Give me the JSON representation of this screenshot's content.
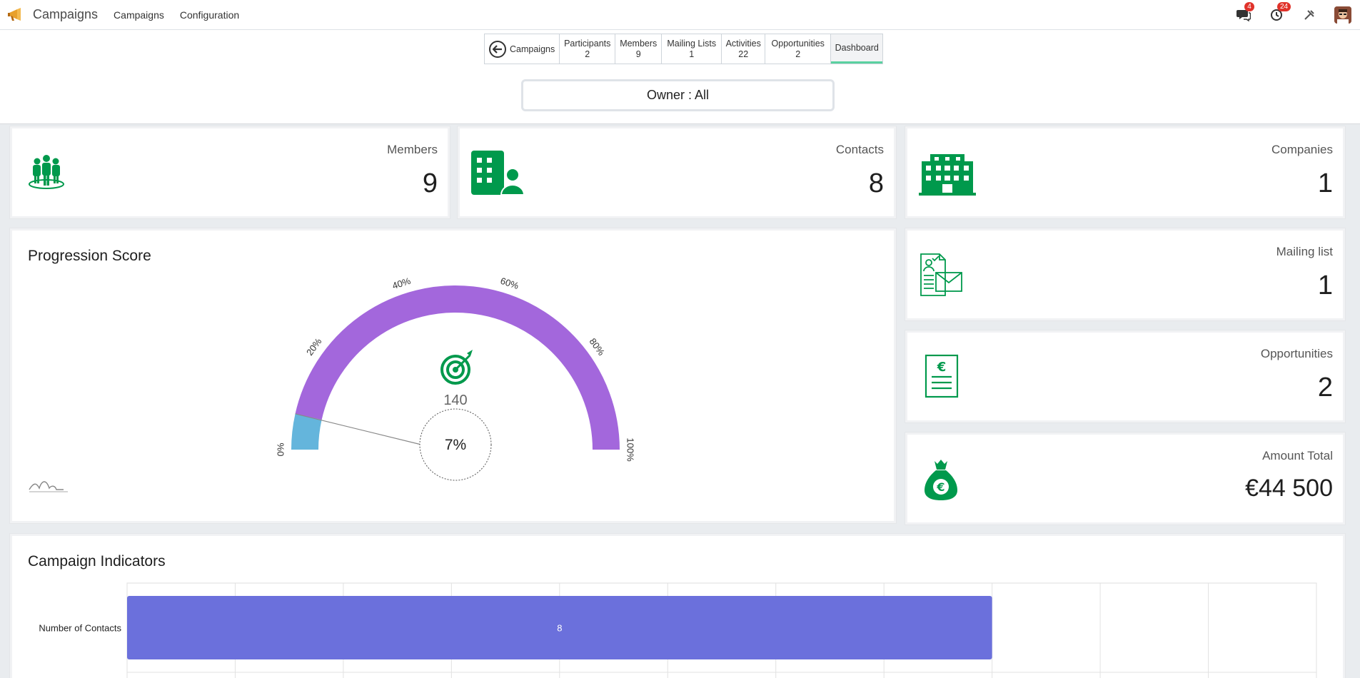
{
  "nav": {
    "app_name": "Campaigns",
    "menu": [
      "Campaigns",
      "Configuration"
    ],
    "messages_badge": "4",
    "activities_badge": "24"
  },
  "smart_buttons": {
    "back_label": "Campaigns",
    "items": [
      {
        "label": "Participants",
        "count": "2"
      },
      {
        "label": "Members",
        "count": "9"
      },
      {
        "label": "Mailing Lists",
        "count": "1"
      },
      {
        "label": "Activities",
        "count": "22"
      },
      {
        "label": "Opportunities",
        "count": "2"
      }
    ],
    "dashboard_label": "Dashboard"
  },
  "filter": {
    "owner_label": "Owner : All"
  },
  "kpis": {
    "members": {
      "label": "Members",
      "value": "9"
    },
    "contacts": {
      "label": "Contacts",
      "value": "8"
    },
    "companies": {
      "label": "Companies",
      "value": "1"
    },
    "mailing_list": {
      "label": "Mailing list",
      "value": "1"
    },
    "opportunities": {
      "label": "Opportunities",
      "value": "2"
    },
    "amount_total": {
      "label": "Amount Total",
      "value": "€44 500"
    }
  },
  "progression": {
    "title": "Progression Score",
    "target": "140",
    "percent_label": "7%",
    "percent": 7,
    "ticks": [
      "0%",
      "20%",
      "40%",
      "60%",
      "80%",
      "100%"
    ],
    "colors": {
      "filled": "#64b5dc",
      "rest": "#a367dc"
    }
  },
  "indicators": {
    "title": "Campaign Indicators"
  },
  "chart_data": {
    "type": "bar",
    "orientation": "horizontal",
    "categories": [
      "Number of Contacts"
    ],
    "values": [
      8
    ],
    "data_labels": [
      "8"
    ],
    "xlim": [
      0,
      11
    ],
    "grid": true,
    "color": "#6b70dc"
  },
  "colors": {
    "icon_green": "#00994c",
    "accent": "#5ad1a0"
  }
}
